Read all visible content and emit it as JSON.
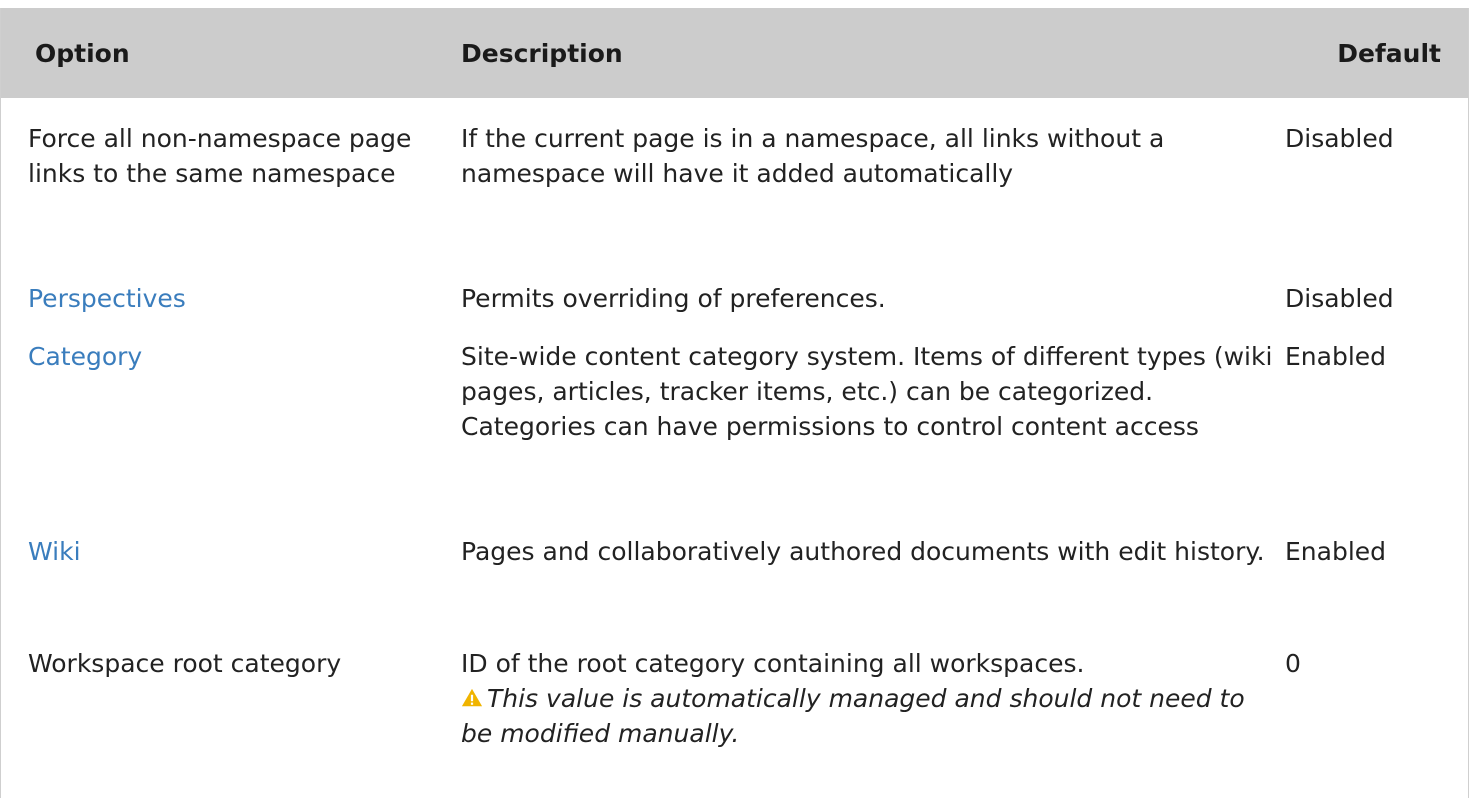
{
  "table": {
    "headers": {
      "option": "Option",
      "description": "Description",
      "default": "Default"
    },
    "rows": [
      {
        "option": "Force all non-namespace page links to the same namespace",
        "option_is_link": false,
        "description": "If the current page is in a namespace, all links without a namespace will have it added automatically",
        "default": "Disabled"
      },
      {
        "option": "Perspectives",
        "option_is_link": true,
        "description": "Permits overriding of preferences.",
        "default": "Disabled"
      },
      {
        "option": "Category",
        "option_is_link": true,
        "description": "Site-wide content category system. Items of different types (wiki pages, articles, tracker items, etc.) can be categorized. Categories can have permissions to control content access",
        "default": "Enabled"
      },
      {
        "option": "Wiki",
        "option_is_link": true,
        "description": "Pages and collaboratively authored documents with edit history.",
        "default": "Enabled"
      },
      {
        "option": "Workspace root category",
        "option_is_link": false,
        "description": "ID of the root category containing all workspaces.",
        "warning": "This value is automatically managed and should not need to be modified manually.",
        "warning_icon": "warning-triangle-icon",
        "default": "0"
      }
    ]
  },
  "colors": {
    "header_bg": "#cccccc",
    "link": "#3a7dbd",
    "warning_icon": "#f0b400"
  }
}
